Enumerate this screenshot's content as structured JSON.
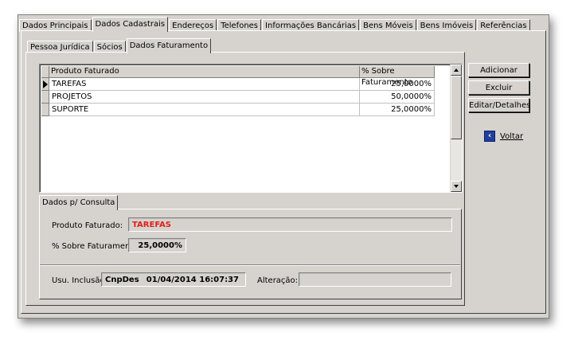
{
  "main_tabs": [
    "Dados Principais",
    "Dados Cadastrais",
    "Endereços",
    "Telefones",
    "Informações Bancárias",
    "Bens Móveis",
    "Bens Imóveis",
    "Referências"
  ],
  "main_active": "Dados Cadastrais",
  "sub_tabs": [
    "Pessoa Jurídica",
    "Sócios",
    "Dados Faturamento"
  ],
  "sub_active": "Dados Faturamento",
  "grid": {
    "columns": [
      "Produto Faturado",
      "% Sobre Faturamento"
    ],
    "rows": [
      {
        "produto": "TAREFAS",
        "percentual": "25,0000%",
        "current": true
      },
      {
        "produto": "PROJETOS",
        "percentual": "50,0000%",
        "current": false
      },
      {
        "produto": "SUPORTE",
        "percentual": "25,0000%",
        "current": false
      }
    ]
  },
  "buttons": {
    "add": "Adicionar",
    "delete": "Excluir",
    "edit": "Editar/Detalhes",
    "back": "Voltar"
  },
  "consulta": {
    "tab": "Dados p/ Consulta",
    "produto_label": "Produto Faturado:",
    "produto_value": "TAREFAS",
    "percent_label": "% Sobre Faturamento",
    "percent_value": "25,0000%",
    "usu_label": "Usu. Inclusão:",
    "usu_name": "CnpDes",
    "usu_datetime": "01/04/2014 16:07:37",
    "alteracao_label": "Alteração:",
    "alteracao_value": ""
  },
  "colors": {
    "highlight_text": "#e0201b",
    "icon_blue": "#1f3f9c"
  }
}
